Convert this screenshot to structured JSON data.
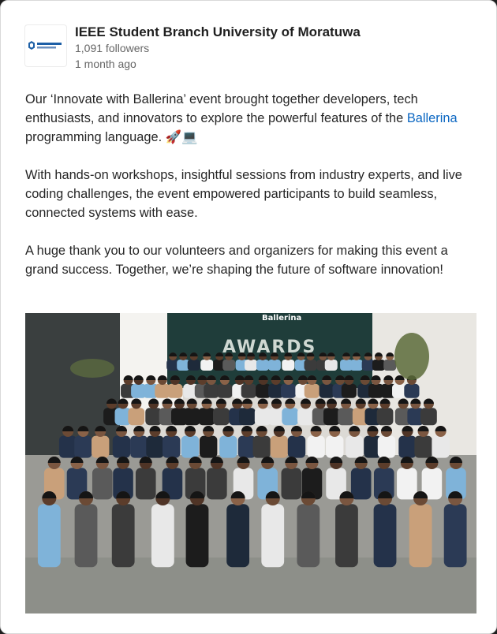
{
  "post": {
    "author": {
      "name": "IEEE Student Branch University of Moratuwa",
      "followers": "1,091 followers",
      "time": "1 month ago",
      "logo_icon": "ieee-branch-logo"
    },
    "body": {
      "p1_before": "Our ‘Innovate with Ballerina’ event brought together developers, tech enthusiasts, and innovators to explore the powerful features of the ",
      "p1_link": "Ballerina",
      "p1_after": " programming language. 🚀💻",
      "p2": "With hands-on workshops, insightful sessions from industry experts, and live coding challenges, the event empowered participants to build seamless, connected systems with ease.",
      "p3": "A huge thank you to our volunteers and organizers for making this event a grand success. Together, we’re shaping the future of software innovation!"
    },
    "image": {
      "banner_brand": "Ballerina",
      "banner_text": "AWARDS",
      "colors": {
        "banner": "#1f3d3a",
        "floor": "#8d8f89",
        "wall": "#e9e7e2"
      }
    },
    "colors": {
      "link": "#0a66c2",
      "text": "#262626",
      "muted": "#666666"
    }
  }
}
